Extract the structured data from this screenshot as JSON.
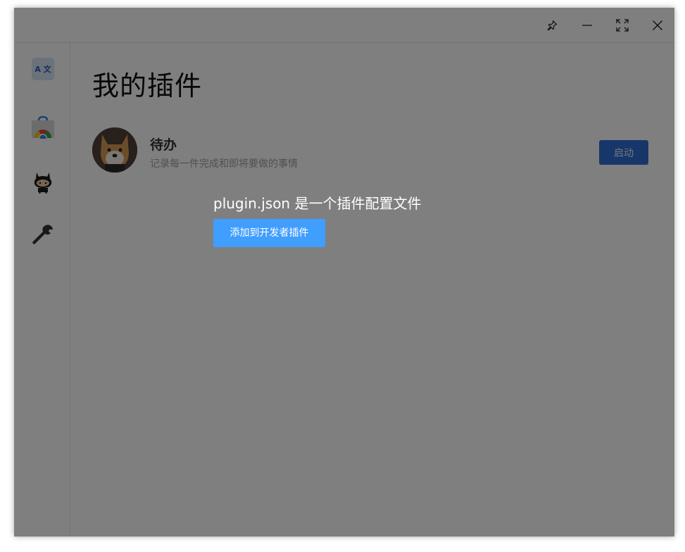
{
  "window": {
    "controls": [
      "pin-icon",
      "minimize-icon",
      "fullscreen-icon",
      "close-icon"
    ]
  },
  "sidebar": {
    "items": [
      {
        "icon": "translate-icon",
        "label": "A 文"
      },
      {
        "icon": "store-icon"
      },
      {
        "icon": "github-icon"
      },
      {
        "icon": "wrench-icon"
      }
    ]
  },
  "main": {
    "title": "我的插件",
    "plugins": [
      {
        "name": "待办",
        "description": "记录每一件完成和即将要做的事情",
        "action_label": "启动",
        "avatar_icon": "dog-avatar-icon"
      }
    ]
  },
  "drop_overlay": {
    "label": "plugin.json 是一个插件配置文件",
    "button_label": "添加到开发者插件"
  },
  "colors": {
    "accent": "#409eff",
    "start_button": "#2e6fd6",
    "overlay": "rgba(0,0,0,0.5)"
  }
}
